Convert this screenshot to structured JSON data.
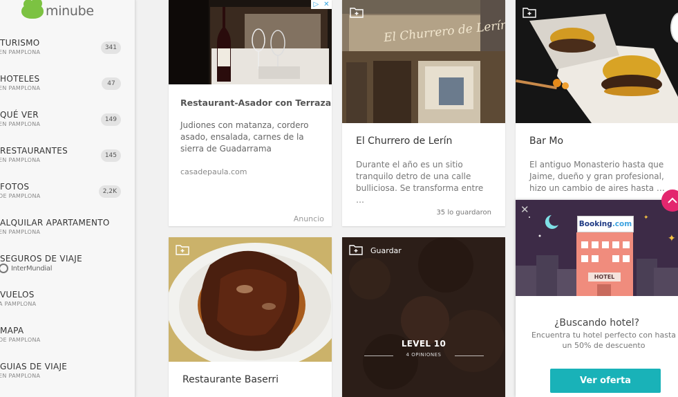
{
  "brand": {
    "name": "minube",
    "color": "#7cc242"
  },
  "sidebar": {
    "items": [
      {
        "label": "TURISMO",
        "sub": "EN PAMPLONA",
        "count": "341"
      },
      {
        "label": "HOTELES",
        "sub": "EN PAMPLONA",
        "count": "47"
      },
      {
        "label": "QUÉ VER",
        "sub": "EN PAMPLONA",
        "count": "149"
      },
      {
        "label": "RESTAURANTES",
        "sub": "EN PAMPLONA",
        "count": "145"
      },
      {
        "label": "FOTOS",
        "sub": "DE PAMPLONA",
        "count": "2,2K"
      },
      {
        "label": "ALQUILAR APARTAMENTO",
        "sub": "EN PAMPLONA"
      },
      {
        "label": "SEGUROS DE VIAJE",
        "sponsor": "InterMundial"
      },
      {
        "label": "VUELOS",
        "sub": "A PAMPLONA"
      },
      {
        "label": "MAPA",
        "sub": "DE PAMPLONA"
      },
      {
        "label": "GUIAS DE VIAJE",
        "sub": "EN PAMPLONA"
      }
    ]
  },
  "ad": {
    "title": "Restaurant-Asador con Terraza",
    "description": "Judiones con matanza, cordero asado, ensalada, carnes de la sierra de Guadarrama",
    "url": "casadepaula.com",
    "label": "Anuncio"
  },
  "cards": {
    "churrero": {
      "title": "El Churrero de Lerín",
      "description": "Durante el año es un sitio tranquilo detro de una calle bulliciosa. Se transforma entre …",
      "saved": "35 lo guardaron",
      "sign": "El Churrero de Lerín"
    },
    "barmo": {
      "title": "Bar Mo",
      "description": "El antiguo Monasterio hasta que Jaime, dueño y gran profesional, hizo un cambio de aires hasta …"
    },
    "baserri": {
      "title": "Restaurante Baserri"
    },
    "level": {
      "save_label": "Guardar",
      "level": "LEVEL 10",
      "reviews": "4 OPINIONES"
    }
  },
  "booking": {
    "logo_main": "Booking",
    "logo_suffix": ".com",
    "sign": "HOTEL",
    "heading": "¿Buscando hotel?",
    "sub": "Encuentra tu hotel perfecto con hasta un 50% de descuento",
    "cta": "Ver oferta",
    "accent": "#19b2b8"
  },
  "colors": {
    "scroll_top": "#e3276e"
  }
}
